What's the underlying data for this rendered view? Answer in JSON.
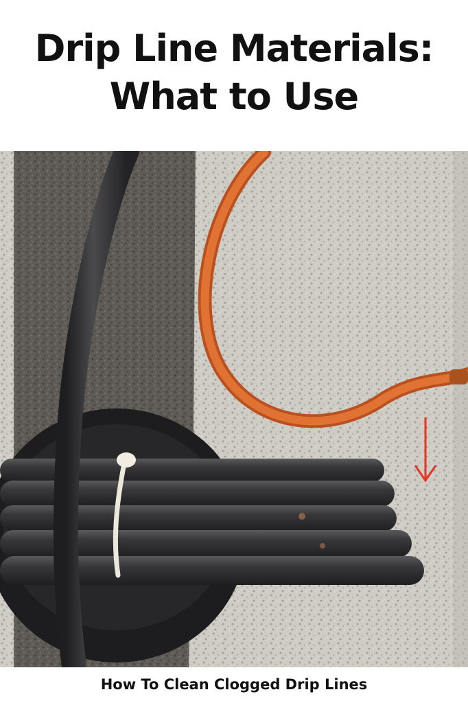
{
  "title": {
    "line1": "Drip Line Materials:",
    "line2": "What to Use"
  },
  "photo": {
    "subject": "drip-irrigation-tubing-photo",
    "colors": {
      "dark_gravel": "#5e5a55",
      "light_wall": "#cfccc6",
      "black_tubing": "#2e2e30",
      "orange_tubing": "#d9662c",
      "zip_tie": "#ece8dc",
      "red_arrow": "#e2382a"
    }
  },
  "caption": "How To Clean Clogged Drip Lines"
}
